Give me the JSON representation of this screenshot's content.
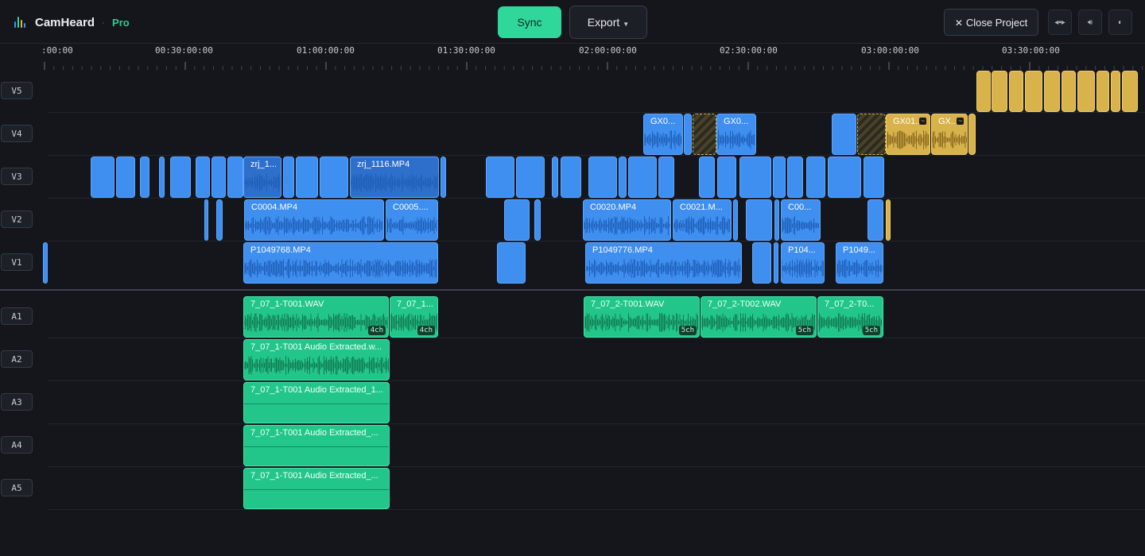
{
  "header": {
    "app_name": "CamHeard",
    "separator": "·",
    "tier": "Pro",
    "sync_label": "Sync",
    "export_label": "Export",
    "close_label": "Close Project",
    "icons": [
      "waveform-logo-icon",
      "caret-down-icon",
      "close-icon",
      "sync-view-icon",
      "volume-icon",
      "theme-toggle-icon"
    ]
  },
  "colors": {
    "video_clip": "#3f8ff0",
    "audio_clip": "#23c68a",
    "gold_clip": "#d8b24a",
    "accent": "#2fd79a",
    "background": "#14161b"
  },
  "ruler": {
    "labels": [
      ":00:00",
      "00:30:00:00",
      "01:00:00:00",
      "01:30:00:00",
      "02:00:00:00",
      "02:30:00:00",
      "03:00:00:00",
      "03:30:00:00"
    ]
  },
  "tracks": {
    "video": [
      "V5",
      "V4",
      "V3",
      "V2",
      "V1"
    ],
    "audio": [
      "A1",
      "A2",
      "A3",
      "A4",
      "A5"
    ]
  },
  "clips": {
    "v4": [
      "GX0...",
      "GX0...",
      "GX01...",
      "GX..."
    ],
    "v3": [
      "zrj_1...",
      "zrj_1116.MP4"
    ],
    "v2": [
      "C0004.MP4",
      "C0005....",
      "C0020.MP4",
      "C0021.M...",
      "C00..."
    ],
    "v1": [
      "P1049768.MP4",
      "P1049776.MP4",
      "P104...",
      "P1049..."
    ],
    "a1": [
      "7_07_1-T001.WAV",
      "7_07_1...",
      "7_07_2-T001.WAV",
      "7_07_2-T002.WAV",
      "7_07_2-T0..."
    ],
    "a1_channels": [
      "4ch",
      "4ch",
      "5ch",
      "5ch",
      "5ch"
    ],
    "a2": "7_07_1-T001 Audio Extracted.w...",
    "a3": "7_07_1-T001 Audio Extracted_1...",
    "a4": "7_07_1-T001 Audio Extracted_...",
    "a5": "7_07_1-T001 Audio Extracted_..."
  }
}
